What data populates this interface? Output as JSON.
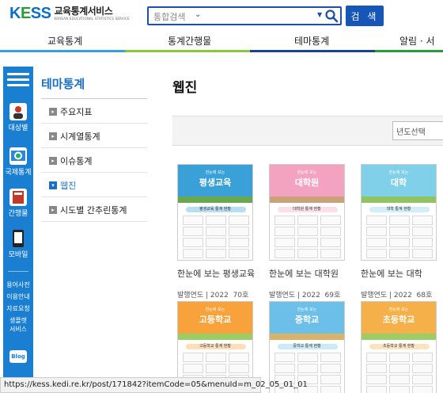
{
  "header": {
    "logo_mark": [
      "K",
      "E",
      "SS"
    ],
    "logo_ko": "교육통계서비스",
    "logo_en": "KOREAN EDUCATIONAL STATISTICS SERVICE",
    "search_placeholder": "통합검색",
    "search_button": "검 색"
  },
  "gnb": {
    "items": [
      "교육통계",
      "통계간행물",
      "테마통계",
      "알림 · 서"
    ],
    "bar_colors": [
      "#3a9fd8",
      "#8cc63f",
      "#1f3f8f",
      "#2a9d3a"
    ]
  },
  "quickbar": {
    "items": [
      "대상별",
      "국제통계",
      "간행물",
      "모바일"
    ],
    "small_items": [
      "용어사전",
      "이용안내",
      "자료요청",
      "생플렛",
      "서비스"
    ],
    "blog": "Blog",
    "icons": [
      "menu-icon",
      "person-icon",
      "globe-icon",
      "book-icon",
      "mobile-icon"
    ]
  },
  "lnb": {
    "title": "테마통계",
    "items": [
      {
        "label": "주요지표",
        "active": false
      },
      {
        "label": "시계열통계",
        "active": false
      },
      {
        "label": "이슈통계",
        "active": false
      },
      {
        "label": "웹진",
        "active": true
      },
      {
        "label": "시도별 간추린통계",
        "active": false
      }
    ]
  },
  "main": {
    "title": "웹진",
    "year_select": "년도선택",
    "cards": [
      {
        "cover_title": "평생교육",
        "cover_sub": "한눈에 보는",
        "band": "평생교육 통계 현황",
        "title": "한눈에 보는 평생교육",
        "meta_label": "발행연도",
        "year": "2022",
        "issue": "70호",
        "sky": "#3aa0d8",
        "ground": "#6aa84f"
      },
      {
        "cover_title": "대학원",
        "cover_sub": "한눈에 보는",
        "band": "대학원 통계 현황",
        "title": "한눈에 보는 대학원",
        "meta_label": "발행연도",
        "year": "2022",
        "issue": "69호",
        "sky": "#f3a3c0",
        "ground": "#c9a27a"
      },
      {
        "cover_title": "대학",
        "cover_sub": "한눈에 보는",
        "band": "대학 통계 현황",
        "title": "한눈에 보는 대학",
        "meta_label": "발행연도",
        "year": "2022",
        "issue": "68호",
        "sky": "#7fd0e8",
        "ground": "#8fc460"
      },
      {
        "cover_title": "고등학교",
        "cover_sub": "한눈에 보는",
        "band": "고등학교 통계 현황",
        "title": "",
        "meta_label": "",
        "year": "",
        "issue": "",
        "sky": "#f7a23a",
        "ground": "#9ccc65"
      },
      {
        "cover_title": "중학교",
        "cover_sub": "한눈에 보는",
        "band": "중학교 통계 현황",
        "title": "",
        "meta_label": "",
        "year": "",
        "issue": "",
        "sky": "#6bbfe8",
        "ground": "#d9b36b"
      },
      {
        "cover_title": "초등학교",
        "cover_sub": "한눈에 보는",
        "band": "초등학교 통계 현황",
        "title": "",
        "meta_label": "",
        "year": "",
        "issue": "",
        "sky": "#f5b04a",
        "ground": "#9ccc65"
      }
    ]
  },
  "statusbar": {
    "url": "https://kess.kedi.re.kr/post/171842?itemCode=05&menuId=m_02_05_01_01"
  }
}
